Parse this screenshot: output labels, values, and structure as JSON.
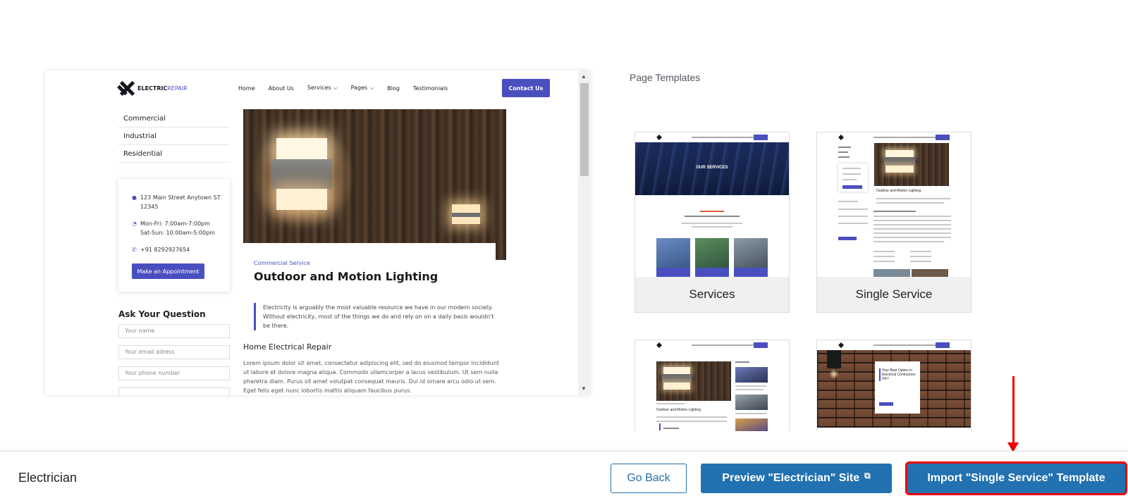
{
  "preview": {
    "logo": {
      "primary": "ELECTRIC",
      "secondary": "REPAIR"
    },
    "nav": [
      "Home",
      "About Us",
      "Services",
      "Pages",
      "Blog",
      "Testimonials"
    ],
    "nav_cta": "Contact Us",
    "categories": [
      "Commercial",
      "Industrial",
      "Residential"
    ],
    "contact": {
      "address_line1": "123 Main Street Anytown ST",
      "address_line2": "12345",
      "hours_line1": "Mon-Fri: 7:00am-7:00pm",
      "hours_line2": "Sat-Sun: 10:00am-5:00pm",
      "phone": "+91 8292927654",
      "button": "Make an Appointment"
    },
    "ask_title": "Ask Your Question",
    "fields": [
      "Your name",
      "Your email adress",
      "Your phone number"
    ],
    "service_kicker": "Commercial Service",
    "service_title": "Outdoor and Motion Lighting",
    "quote": "Electricity is arguably the most valuable resource we have in our modern society. Without electricity, most of the things we do and rely on on a daily basis wouldn't be there.",
    "subheading": "Home Electrical Repair",
    "body": "Lorem ipsum dolor sit amet, consectetur adipiscing elit, sed do eiusmod tempor incididunt ut labore et dolore magna aliqua. Commodo ullamcorper a lacus vestibulum. Ut sem nulla pharetra diam. Purus sit amet volutpat consequat mauris. Dui id ornare arcu odio ut sem. Eget felis eget nunc lobortis mattis aliquam faucibus purus."
  },
  "templates": {
    "section_label": "Page Templates",
    "cards": [
      {
        "label": "Services",
        "thumb_text": "OUR SERVICES"
      },
      {
        "label": "Single Service",
        "thumb_text": "Outdoor and Motion Lighting"
      },
      {
        "label": "",
        "thumb_text": "Outdoor and Motion Lighting"
      },
      {
        "label": "",
        "thumb_text": "Your Best Option in Electrical Contractors 24/7"
      }
    ]
  },
  "footer": {
    "title": "Electrician",
    "back_button": "Go Back",
    "preview_button": "Preview \"Electrician\" Site",
    "import_button": "Import \"Single Service\" Template"
  },
  "colors": {
    "accent": "#2271b1",
    "brand": "#4a4fbf",
    "highlight": "#ee0000"
  },
  "icons": [
    "map-pin-icon",
    "clock-icon",
    "phone-icon",
    "chevron-down-icon",
    "external-link-icon",
    "scroll-up-icon",
    "scroll-down-icon"
  ]
}
